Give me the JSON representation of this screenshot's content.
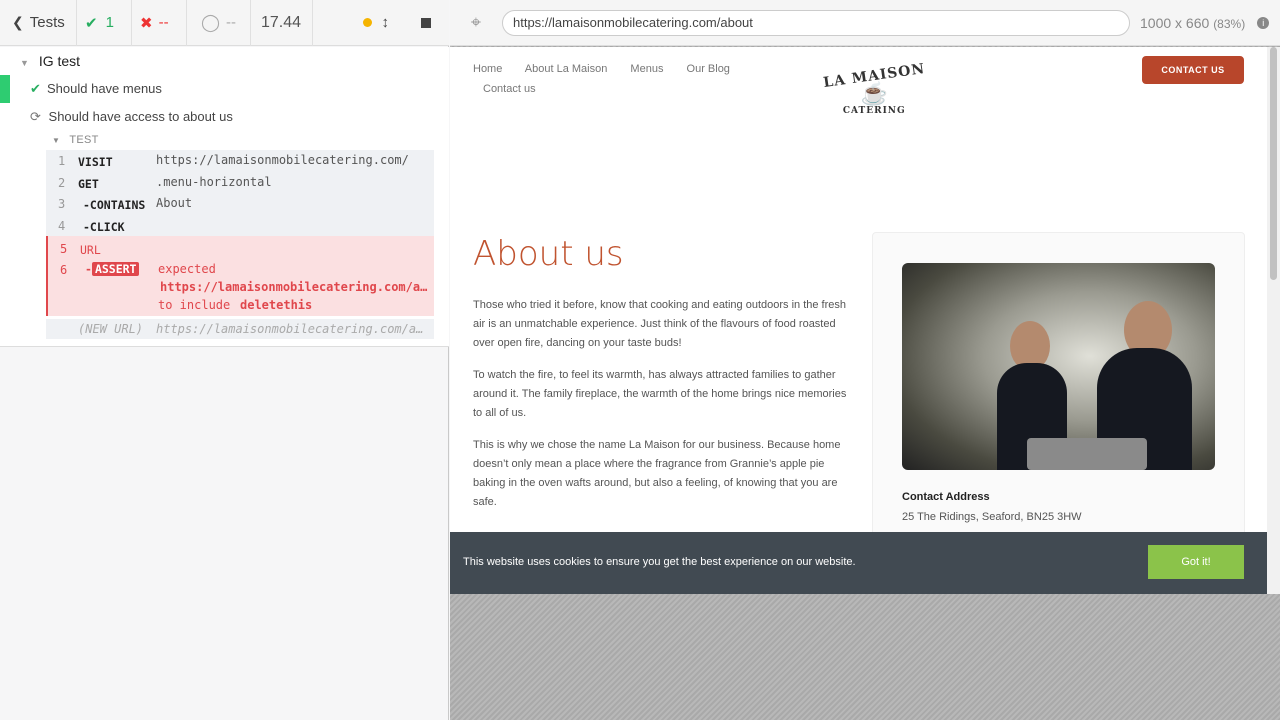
{
  "toolbar": {
    "tests_label": "Tests",
    "passed": "1",
    "failed": "--",
    "pending": "--",
    "duration": "17.44"
  },
  "runner": {
    "suite": "IG test",
    "test1": "Should have menus",
    "test2": "Should have access to about us",
    "section": "TEST",
    "commands": [
      {
        "n": "1",
        "cmd": "VISIT",
        "arg": "https://lamaisonmobilecatering.com/"
      },
      {
        "n": "2",
        "cmd": "GET",
        "arg": ".menu-horizontal"
      },
      {
        "n": "3",
        "cmd": "-CONTAINS",
        "arg": "About"
      },
      {
        "n": "4",
        "cmd": "-CLICK",
        "arg": ""
      }
    ],
    "error": {
      "n5": "5",
      "cmd5": "URL",
      "n6": "6",
      "assert": "ASSERT",
      "expected": "expected",
      "url": "https://lamaisonmobilecatering.com/a…",
      "include": "to include",
      "value": "deletethis"
    },
    "new_url_label": "(NEW URL)",
    "new_url": "https://lamaisonmobilecatering.com/a…"
  },
  "browser": {
    "url": "https://lamaisonmobilecatering.com/about",
    "dims": "1000 x 660",
    "zoom": "(83%)"
  },
  "site": {
    "nav": [
      "Home",
      "About La Maison",
      "Menus",
      "Our Blog"
    ],
    "nav2": "Contact us",
    "logo_top": "LA MAISON",
    "logo_bottom": "CATERING",
    "contact_btn": "CONTACT US",
    "heading": "About us",
    "p1": "Those who tried it before, know that cooking and eating outdoors in the fresh air is an unmatchable experience. Just think of the flavours of food roasted over open fire, dancing on your taste buds!",
    "p2": "To watch the fire, to feel its warmth, has always attracted families to gather around it. The family fireplace, the warmth of the home brings nice memories to all of us.",
    "p3": "This is why we chose the name La Maison for our business. Because home doesn’t only mean a place where the fragrance from Grannie’s apple pie baking in the oven wafts around, but also a feeling, of knowing that you are safe.",
    "contact_title": "Contact Address",
    "contact_value": "25 The Ridings, Seaford, BN25 3HW",
    "cookie_text": "This website uses cookies to ensure you get the best experience on our website.",
    "cookie_btn": "Got it!"
  }
}
